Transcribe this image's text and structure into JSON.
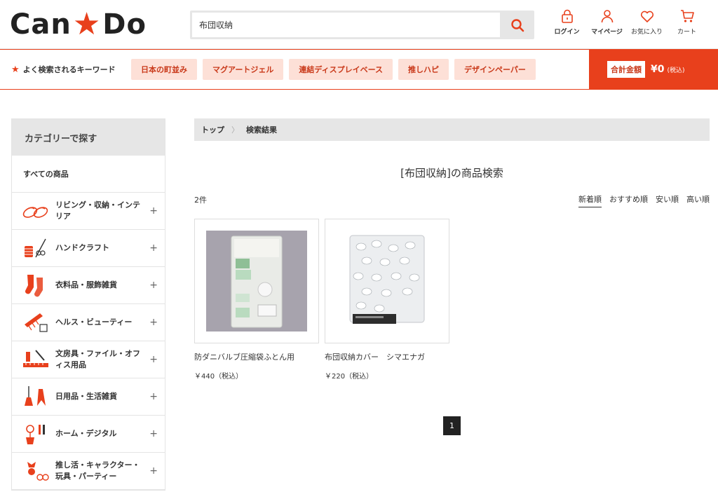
{
  "logo": {
    "left": "Can",
    "star": "★",
    "right": "Do"
  },
  "search": {
    "value": "布団収納",
    "placeholder": ""
  },
  "nav": [
    {
      "label": "ログイン",
      "icon": "lock-icon"
    },
    {
      "label": "マイページ",
      "icon": "person-icon"
    },
    {
      "label": "お気に入り",
      "icon": "heart-icon"
    },
    {
      "label": "カート",
      "icon": "cart-icon"
    }
  ],
  "keywords": {
    "title": "よく検索されるキーワード",
    "items": [
      "日本の町並み",
      "マグアートジェル",
      "連結ディスプレイベース",
      "推しハピ",
      "デザインペーパー"
    ]
  },
  "total": {
    "label": "合計金額",
    "value": "¥0",
    "tax": "(税込)"
  },
  "sidebar": {
    "title": "カテゴリーで探す",
    "all": "すべての商品",
    "categories": [
      {
        "label": "リビング・収納・インテリア",
        "icon": "slippers-icon"
      },
      {
        "label": "ハンドクラフト",
        "icon": "sewing-icon"
      },
      {
        "label": "衣料品・服飾雑貨",
        "icon": "socks-icon"
      },
      {
        "label": "ヘルス・ビューティー",
        "icon": "comb-icon"
      },
      {
        "label": "文房具・ファイル・オフィス用品",
        "icon": "stationery-icon"
      },
      {
        "label": "日用品・生活雑貨",
        "icon": "broom-icon"
      },
      {
        "label": "ホーム・デジタル",
        "icon": "tools-icon"
      },
      {
        "label": "推し活・キャラクター・玩具・パーティー",
        "icon": "party-icon"
      }
    ]
  },
  "breadcrumb": {
    "top": "トップ",
    "sep": "〉",
    "current": "検索結果"
  },
  "page_title": "[布団収納]の商品検索",
  "result_count": "2件",
  "sort": [
    "新着順",
    "おすすめ順",
    "安い順",
    "高い順"
  ],
  "products": [
    {
      "name": "防ダニバルブ圧縮袋ふとん用",
      "price": "￥440（税込）"
    },
    {
      "name": "布団収納カバー　シマエナガ",
      "price": "￥220（税込）"
    }
  ],
  "pager": {
    "current": "1"
  },
  "colors": {
    "accent": "#e8401c",
    "keyword_bg": "#fde0d7"
  }
}
